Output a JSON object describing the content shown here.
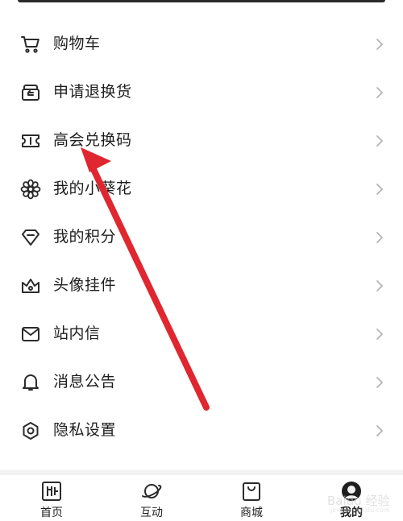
{
  "menu": {
    "items": [
      {
        "label": "购物车",
        "icon": "cart-icon"
      },
      {
        "label": "申请退换货",
        "icon": "return-box-icon"
      },
      {
        "label": "高会兑换码",
        "icon": "ticket-icon"
      },
      {
        "label": "我的小葵花",
        "icon": "flower-icon"
      },
      {
        "label": "我的积分",
        "icon": "diamond-icon"
      },
      {
        "label": "头像挂件",
        "icon": "crown-icon"
      },
      {
        "label": "站内信",
        "icon": "mail-icon"
      },
      {
        "label": "消息公告",
        "icon": "bell-icon"
      },
      {
        "label": "隐私设置",
        "icon": "gear-icon"
      }
    ]
  },
  "tabbar": {
    "tabs": [
      {
        "label": "首页",
        "icon": "home-icon"
      },
      {
        "label": "互动",
        "icon": "planet-icon"
      },
      {
        "label": "商城",
        "icon": "shopping-bag-icon"
      },
      {
        "label": "我的",
        "icon": "avatar-icon",
        "active": true
      }
    ]
  },
  "colors": {
    "text": "#1e1e1e",
    "icon": "#2b2b2b",
    "chevron": "#b5b5b5",
    "annotation_arrow": "#e0262f",
    "divider": "#f2f2f2"
  }
}
